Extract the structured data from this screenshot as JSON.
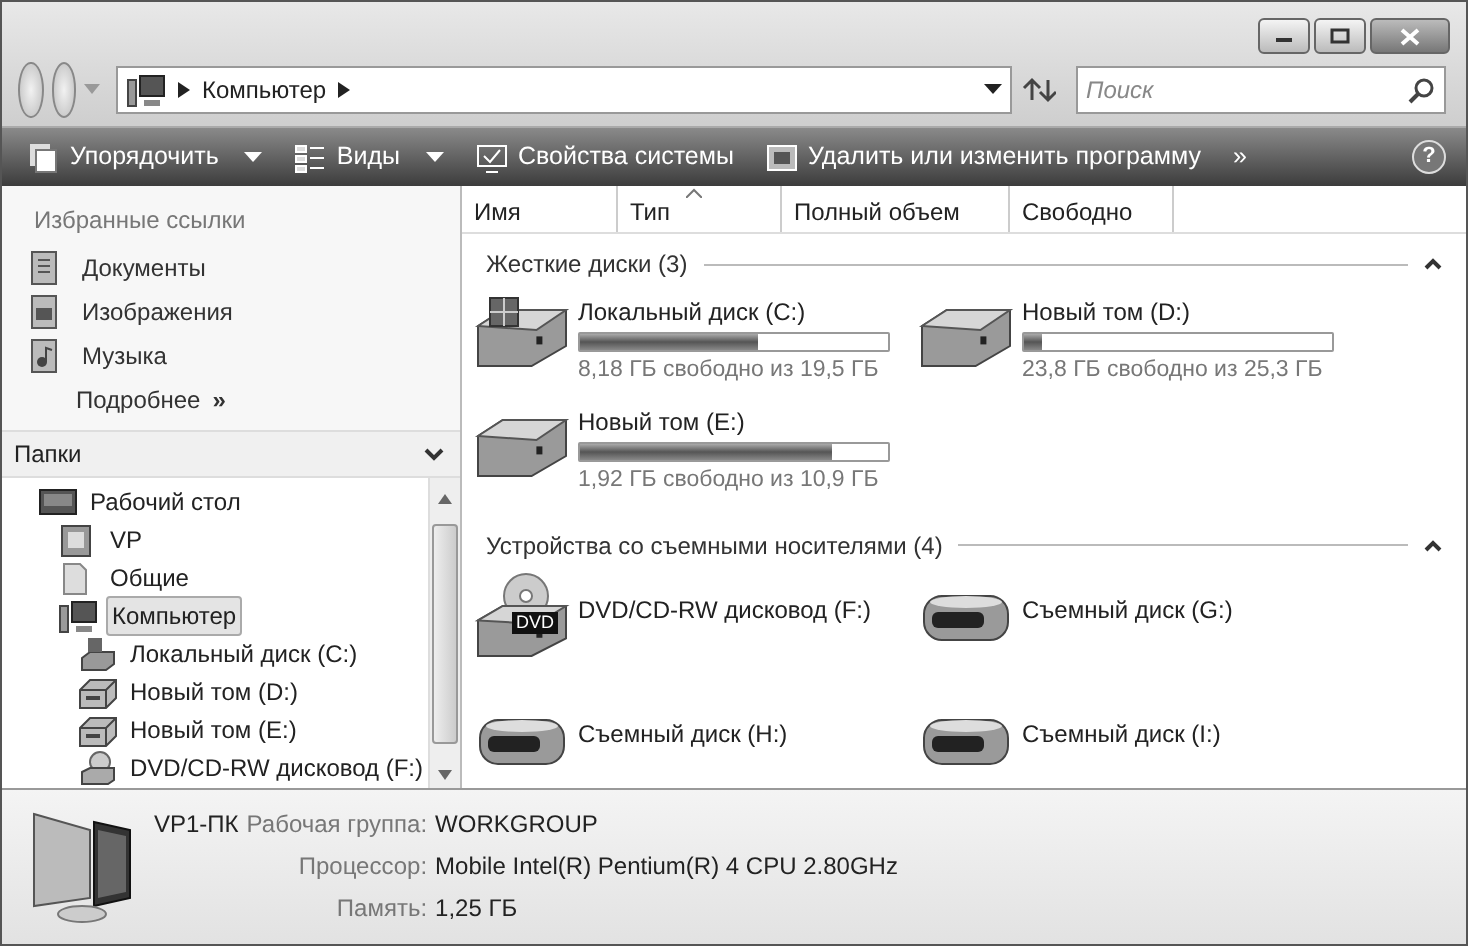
{
  "address": {
    "crumbs": [
      "Компьютер"
    ]
  },
  "search": {
    "placeholder": "Поиск"
  },
  "toolbar": [
    {
      "label": "Упорядочить",
      "kind": "organize",
      "dropdown": true
    },
    {
      "label": "Виды",
      "kind": "views",
      "dropdown": true
    },
    {
      "label": "Свойства системы",
      "kind": "properties",
      "dropdown": false
    },
    {
      "label": "Удалить или изменить программу",
      "kind": "programs",
      "dropdown": false
    }
  ],
  "toolbar_more": "»",
  "help": "?",
  "favorites": {
    "title": "Избранные ссылки",
    "items": [
      {
        "label": "Документы",
        "kind": "documents"
      },
      {
        "label": "Изображения",
        "kind": "pictures"
      },
      {
        "label": "Музыка",
        "kind": "music"
      }
    ],
    "more": {
      "label": "Подробнее",
      "glyph": "»"
    }
  },
  "folders": {
    "title": "Папки",
    "tree": [
      {
        "label": "Рабочий стол",
        "kind": "desktop",
        "selected": false,
        "children": [
          {
            "label": "VP",
            "kind": "user",
            "selected": false
          },
          {
            "label": "Общие",
            "kind": "folder",
            "selected": false
          },
          {
            "label": "Компьютер",
            "kind": "computer",
            "selected": true,
            "children": [
              {
                "label": "Локальный диск (C:)",
                "kind": "system",
                "selected": false
              },
              {
                "label": "Новый том (D:)",
                "kind": "disk",
                "selected": false
              },
              {
                "label": "Новый том (E:)",
                "kind": "disk",
                "selected": false
              },
              {
                "label": "DVD/CD-RW дисковод (F:)",
                "kind": "dvd",
                "selected": false
              }
            ]
          }
        ]
      }
    ]
  },
  "table": {
    "columns": [
      {
        "label": "Имя",
        "sorted": false
      },
      {
        "label": "Тип",
        "sorted": true
      },
      {
        "label": "Полный объем",
        "sorted": false
      },
      {
        "label": "Свободно",
        "sorted": false
      }
    ]
  },
  "groups": [
    {
      "title": "Жесткие диски (3)",
      "items": [
        {
          "name": "Локальный диск (C:)",
          "kind": "system",
          "level": 0.58,
          "free": "8,18 ГБ свободно из 19,5 ГБ"
        },
        {
          "name": "Новый том (D:)",
          "kind": "disk",
          "level": 0.06,
          "free": "23,8 ГБ свободно из 25,3 ГБ"
        },
        {
          "name": "Новый том (E:)",
          "kind": "disk",
          "level": 0.82,
          "free": "1,92 ГБ свободно из 10,9 ГБ"
        }
      ]
    },
    {
      "title": "Устройства со съемными носителями (4)",
      "items": [
        {
          "name": "DVD/CD-RW дисковод (F:)",
          "kind": "dvd",
          "badge": "DVD"
        },
        {
          "name": "Съемный диск (G:)",
          "kind": "removable"
        },
        {
          "name": "Съемный диск (H:)",
          "kind": "removable"
        },
        {
          "name": "Съемный диск (I:)",
          "kind": "removable"
        }
      ]
    }
  ],
  "details": {
    "name": "VP1-ПК",
    "rows": [
      {
        "label": "Рабочая группа:",
        "value": "WORKGROUP"
      },
      {
        "label": "Процессор:",
        "value": "Mobile Intel(R) Pentium(R) 4 CPU 2.80GHz"
      },
      {
        "label": "Память:",
        "value": "1,25 ГБ"
      }
    ]
  }
}
